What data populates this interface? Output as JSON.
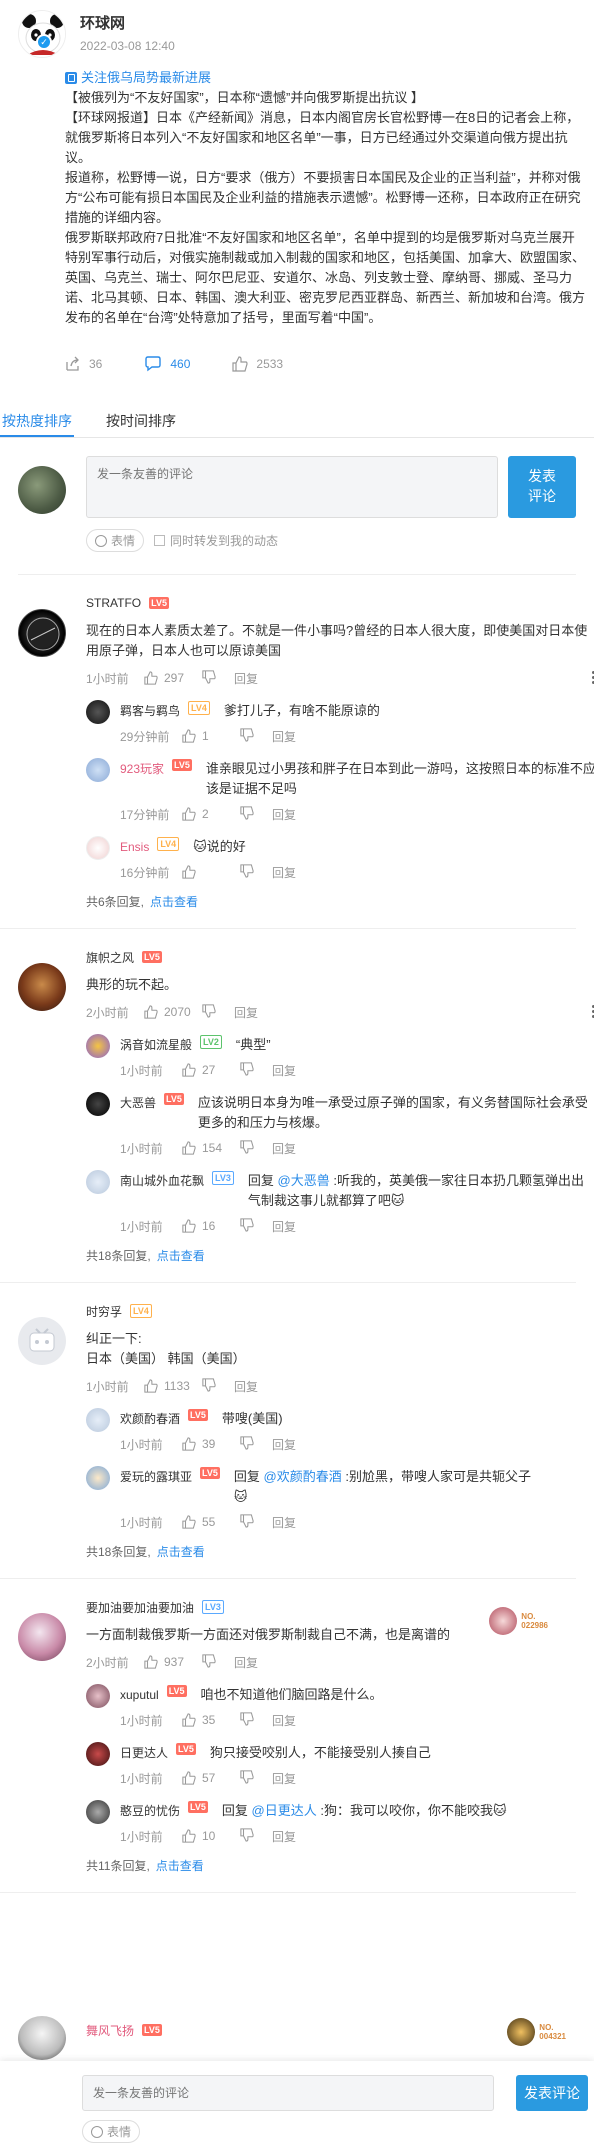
{
  "post": {
    "author": "环球网",
    "time": "2022-03-08 12:40",
    "topic": "关注俄乌局势最新进展",
    "paragraphs": [
      "【被俄列为“不友好国家”，日本称“遗憾”并向俄罗斯提出抗议 】",
      "【环球网报道】日本《产经新闻》消息，日本内阁官房长官松野博一在8日的记者会上称，就俄罗斯将日本列入“不友好国家和地区名单”一事，日方已经通过外交渠道向俄方提出抗议。",
      "报道称，松野博一说，日方“要求（俄方）不要损害日本国民及企业的正当利益”，并称对俄方“公布可能有损日本国民及企业利益的措施表示遗憾”。松野博一还称，日本政府正在研究措施的详细内容。",
      "俄罗斯联邦政府7日批准“不友好国家和地区名单”，名单中提到的均是俄罗斯对乌克兰展开特别军事行动后，对俄实施制裁或加入制裁的国家和地区，包括美国、加拿大、欧盟国家、英国、乌克兰、瑞士、阿尔巴尼亚、安道尔、冰岛、列支敦士登、摩纳哥、挪威、圣马力诺、北马其顿、日本、韩国、澳大利亚、密克罗尼西亚群岛、新西兰、新加坡和台湾。俄方发布的名单在“台湾”处特意加了括号，里面写着“中国”。"
    ],
    "shares": "36",
    "comments": "460",
    "likes": "2533"
  },
  "tabs": [
    "按热度排序",
    "按时间排序"
  ],
  "composer": {
    "placeholder": "发一条友善的评论",
    "send_label": "发表\n评论",
    "emoji_label": "表情",
    "sync_label": "同时转发到我的动态"
  },
  "threads": [
    {
      "user": "STRATFO",
      "level": "LV5",
      "text": "现在的日本人素质太差了。不就是一件小事吗?曾经的日本人很大度，即使美国对日本使用原子弹，日本人也可以原谅美国",
      "time": "1小时前",
      "likes": "297",
      "reply_label": "回复",
      "replies": [
        {
          "user": "羁客与羁鸟",
          "level": "LV4",
          "text": "爹打儿子，有啥不能原谅的",
          "time": "29分钟前",
          "likes": "1"
        },
        {
          "user": "923玩家",
          "level": "LV5",
          "text": "谁亲眼见过小男孩和胖子在日本到此一游吗，这按照日本的标准不应该是证据不足吗",
          "time": "17分钟前",
          "likes": "2"
        },
        {
          "user": "Ensis",
          "level": "LV4",
          "text": "说的好",
          "time": "16分钟前",
          "likes": ""
        }
      ],
      "summary": "共6条回复,",
      "summary_link": "点击查看"
    },
    {
      "user": "旗帜之风",
      "level": "LV5",
      "text": "典形的玩不起。",
      "time": "2小时前",
      "likes": "2070",
      "reply_label": "回复",
      "replies": [
        {
          "user": "涡音如流星般",
          "level": "LV2",
          "text": "“典型”",
          "time": "1小时前",
          "likes": "27"
        },
        {
          "user": "大恶兽",
          "level": "LV5",
          "text": "应该说明日本身为唯一承受过原子弹的国家，有义务替国际社会承受更多的和压力与核爆。",
          "time": "1小时前",
          "likes": "154"
        },
        {
          "user": "南山城外血花飘",
          "level": "LV3",
          "reply_prefix": "回复",
          "mention": "@大恶兽",
          "text": ":听我的，英美俄一家往日本扔几颗氢弹出出气制裁这事儿就都算了吧",
          "time": "1小时前",
          "likes": "16"
        }
      ],
      "summary": "共18条回复,",
      "summary_link": "点击查看"
    },
    {
      "user": "时穷孚",
      "level": "LV4",
      "text": "纠正一下:\n日本（美国） 韩国（美国）",
      "time": "1小时前",
      "likes": "1133",
      "reply_label": "回复",
      "replies": [
        {
          "user": "欢颜酌春酒",
          "level": "LV5",
          "text": "带嗖(美国)",
          "time": "1小时前",
          "likes": "39"
        },
        {
          "user": "爱玩的露琪亚",
          "level": "LV5",
          "reply_prefix": "回复",
          "mention": "@欢颜酌春酒",
          "text": ":别尬黑，带嗖人家可是共轭父子",
          "time": "1小时前",
          "likes": "55"
        }
      ],
      "summary": "共18条回复,",
      "summary_link": "点击查看"
    },
    {
      "user": "要加油要加油要加油",
      "level": "LV3",
      "text": "一方面制裁俄罗斯一方面还对俄罗斯制裁自己不满，也是离谱的",
      "time": "2小时前",
      "likes": "937",
      "reply_label": "回复",
      "medal_text": "NO.\n022986",
      "replies": [
        {
          "user": "xuputul",
          "level": "LV5",
          "text": "咱也不知道他们脑回路是什么。",
          "time": "1小时前",
          "likes": "35"
        },
        {
          "user": "日更达人",
          "level": "LV5",
          "text": "狗只接受咬别人，不能接受别人揍自己",
          "time": "1小时前",
          "likes": "57"
        },
        {
          "user": "憨豆的忧伤",
          "level": "LV5",
          "reply_prefix": "回复",
          "mention": "@日更达人",
          "text": ":狗：我可以咬你，你不能咬我",
          "time": "1小时前",
          "likes": "10"
        }
      ],
      "summary": "共11条回复,",
      "summary_link": "点击查看"
    }
  ],
  "peek": {
    "user": "舞风飞扬",
    "level": "LV5",
    "medal_text": "NO.\n004321"
  },
  "bottom": {
    "placeholder": "发一条友善的评论",
    "send_label": "发表评论",
    "emoji_label": "表情"
  }
}
